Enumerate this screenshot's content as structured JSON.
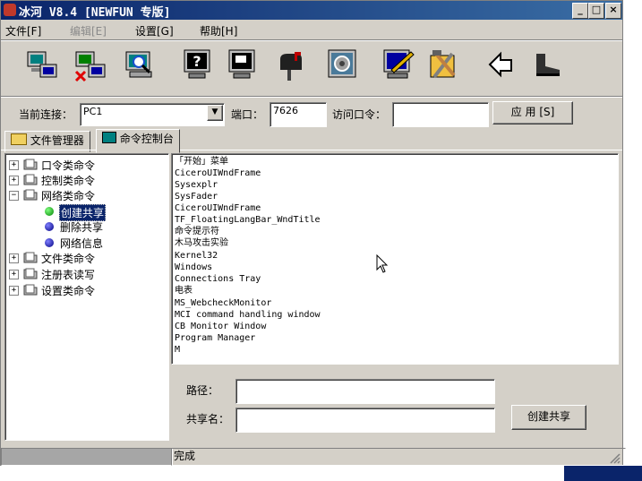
{
  "window": {
    "title": "冰河 V8.4 [NEWFUN 专版]",
    "controls": {
      "minimize": "_",
      "maximize": "□",
      "close": "×"
    }
  },
  "menu": [
    {
      "label": "文件[F]",
      "enabled": true
    },
    {
      "label": "编辑[E]",
      "enabled": false
    },
    {
      "label": "设置[G]",
      "enabled": true
    },
    {
      "label": "帮助[H]",
      "enabled": true
    }
  ],
  "toolbar": {
    "icons": [
      "add-host-icon",
      "delete-host-icon",
      "search-host-icon",
      "help-icon",
      "screen-icon",
      "mailbox-icon",
      "config-icon",
      "edit-icon",
      "tools-icon",
      "arrow-icon",
      "boot-icon"
    ]
  },
  "connection": {
    "current_label": "当前连接：",
    "current_value": "PC1",
    "port_label": "端口：",
    "port_value": "7626",
    "password_label": "访问口令：",
    "password_value": "",
    "apply_label": "应 用 [S]"
  },
  "tabs": [
    {
      "label": "文件管理器",
      "active": false
    },
    {
      "label": "命令控制台",
      "active": true
    }
  ],
  "tree": {
    "nodes": [
      {
        "label": "口令类命令",
        "expanded": false
      },
      {
        "label": "控制类命令",
        "expanded": false
      },
      {
        "label": "网络类命令",
        "expanded": true
      },
      {
        "label": "创建共享",
        "child": true,
        "selected": true,
        "dot": "green"
      },
      {
        "label": "删除共享",
        "child": true,
        "dot": "blue"
      },
      {
        "label": "网络信息",
        "child": true,
        "dot": "blue"
      },
      {
        "label": "文件类命令",
        "expanded": false
      },
      {
        "label": "注册表读写",
        "expanded": false
      },
      {
        "label": "设置类命令",
        "expanded": false
      }
    ]
  },
  "console": {
    "lines": [
      "「开始」菜单",
      "CiceroUIWndFrame",
      "Sysexplr",
      "SysFader",
      "CiceroUIWndFrame",
      "TF_FloatingLangBar_WndTitle",
      "命令提示符",
      "木马攻击实验",
      "Kernel32",
      "Windows",
      "Connections Tray",
      "电表",
      "MS_WebcheckMonitor",
      "MCI command handling window",
      "CB Monitor Window",
      "Program Manager",
      "M"
    ]
  },
  "share_form": {
    "path_label": "路径：",
    "path_value": "",
    "share_label": "共享名：",
    "share_value": "",
    "create_label": "创建共享"
  },
  "status": {
    "text": "完成"
  },
  "colors": {
    "titlebar": "#0a246a",
    "face": "#d4d0c8",
    "selection": "#0a246a"
  }
}
